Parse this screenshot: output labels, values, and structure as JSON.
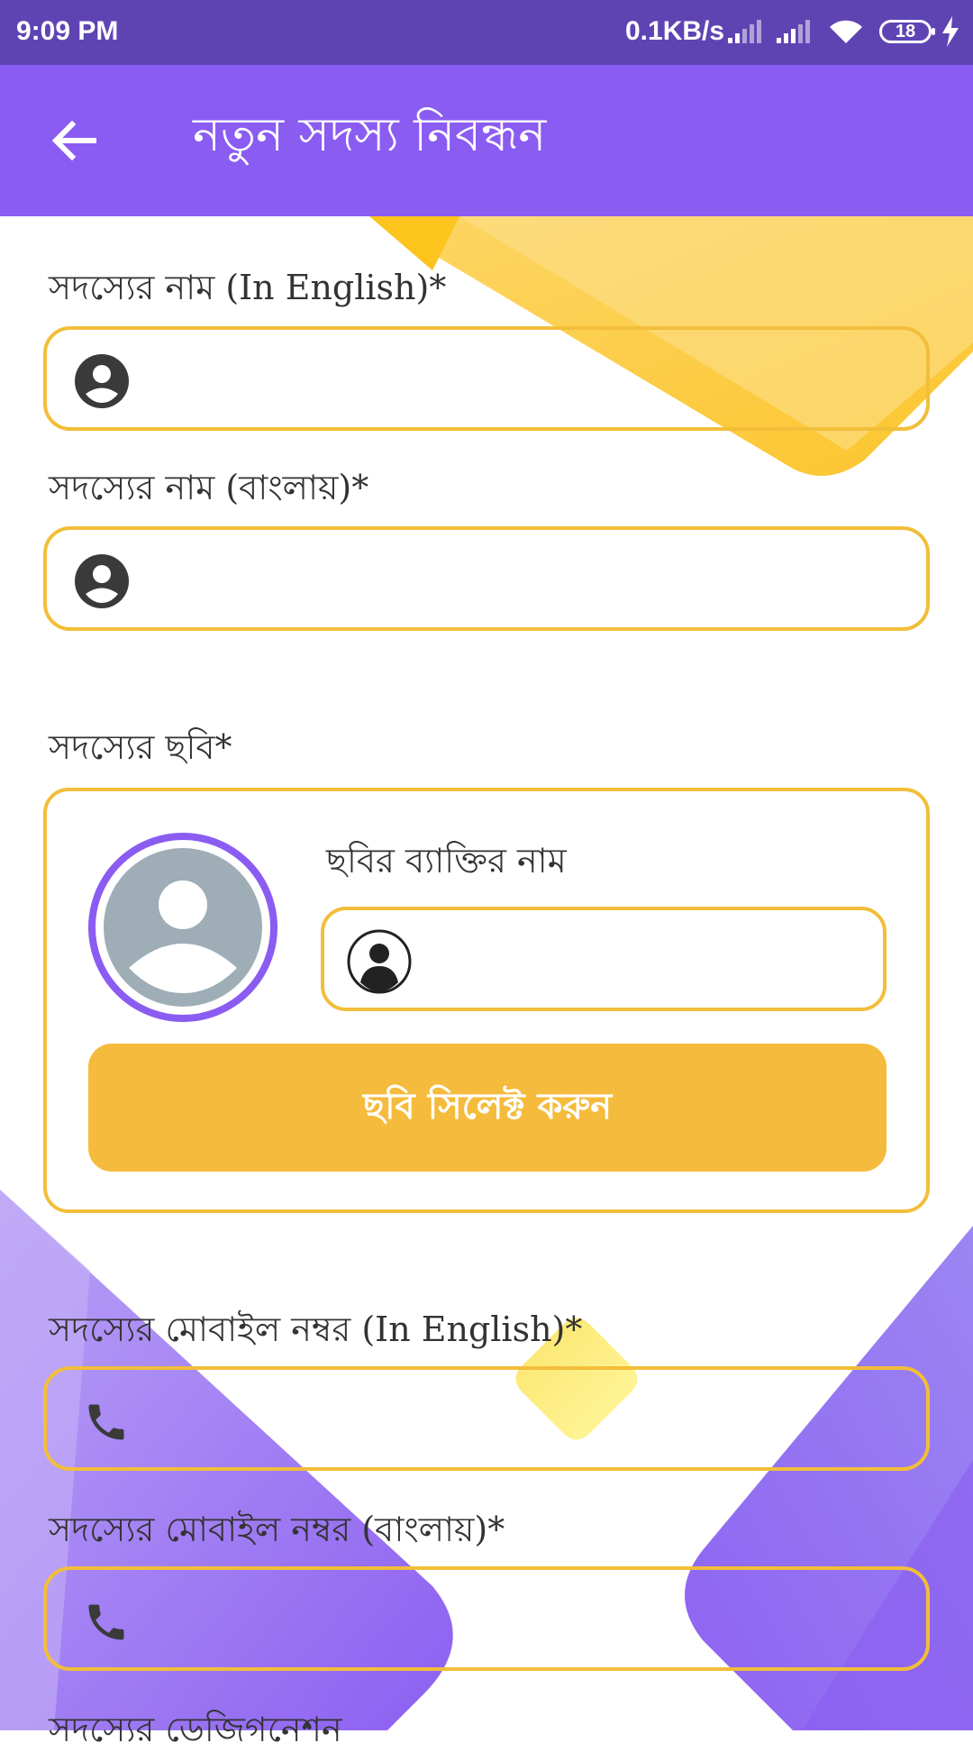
{
  "status_bar": {
    "time": "9:09 PM",
    "network_speed": "0.1KB/s",
    "battery": "18"
  },
  "app_bar": {
    "title": "নতুন সদস্য নিবন্ধন",
    "back_icon": "arrow-back-icon"
  },
  "form": {
    "name_en_label": "সদস্যের নাম (In English)*",
    "name_bn_label": "সদস্যের নাম (বাংলায়)*",
    "photo_label": "সদস্যের ছবি*",
    "photo_person_label": "ছবির ব্যাক্তির নাম",
    "select_photo_button": "ছবি সিলেক্ট করুন",
    "mobile_en_label": "সদস্যের মোবাইল নম্বর (In English)*",
    "mobile_bn_label": "সদস্যের মোবাইল নম্বর (বাংলায়)*",
    "designation_label": "সদস্যের ডেজিগনেশন",
    "name_en_value": "",
    "name_bn_value": "",
    "photo_person_value": "",
    "mobile_en_value": "",
    "mobile_bn_value": ""
  },
  "colors": {
    "status_bar": "#5e44b3",
    "app_bar": "#8b5cf2",
    "field_border": "#f2be3a",
    "button": "#f5bb3c",
    "avatar_ring": "#8b5cf2"
  }
}
